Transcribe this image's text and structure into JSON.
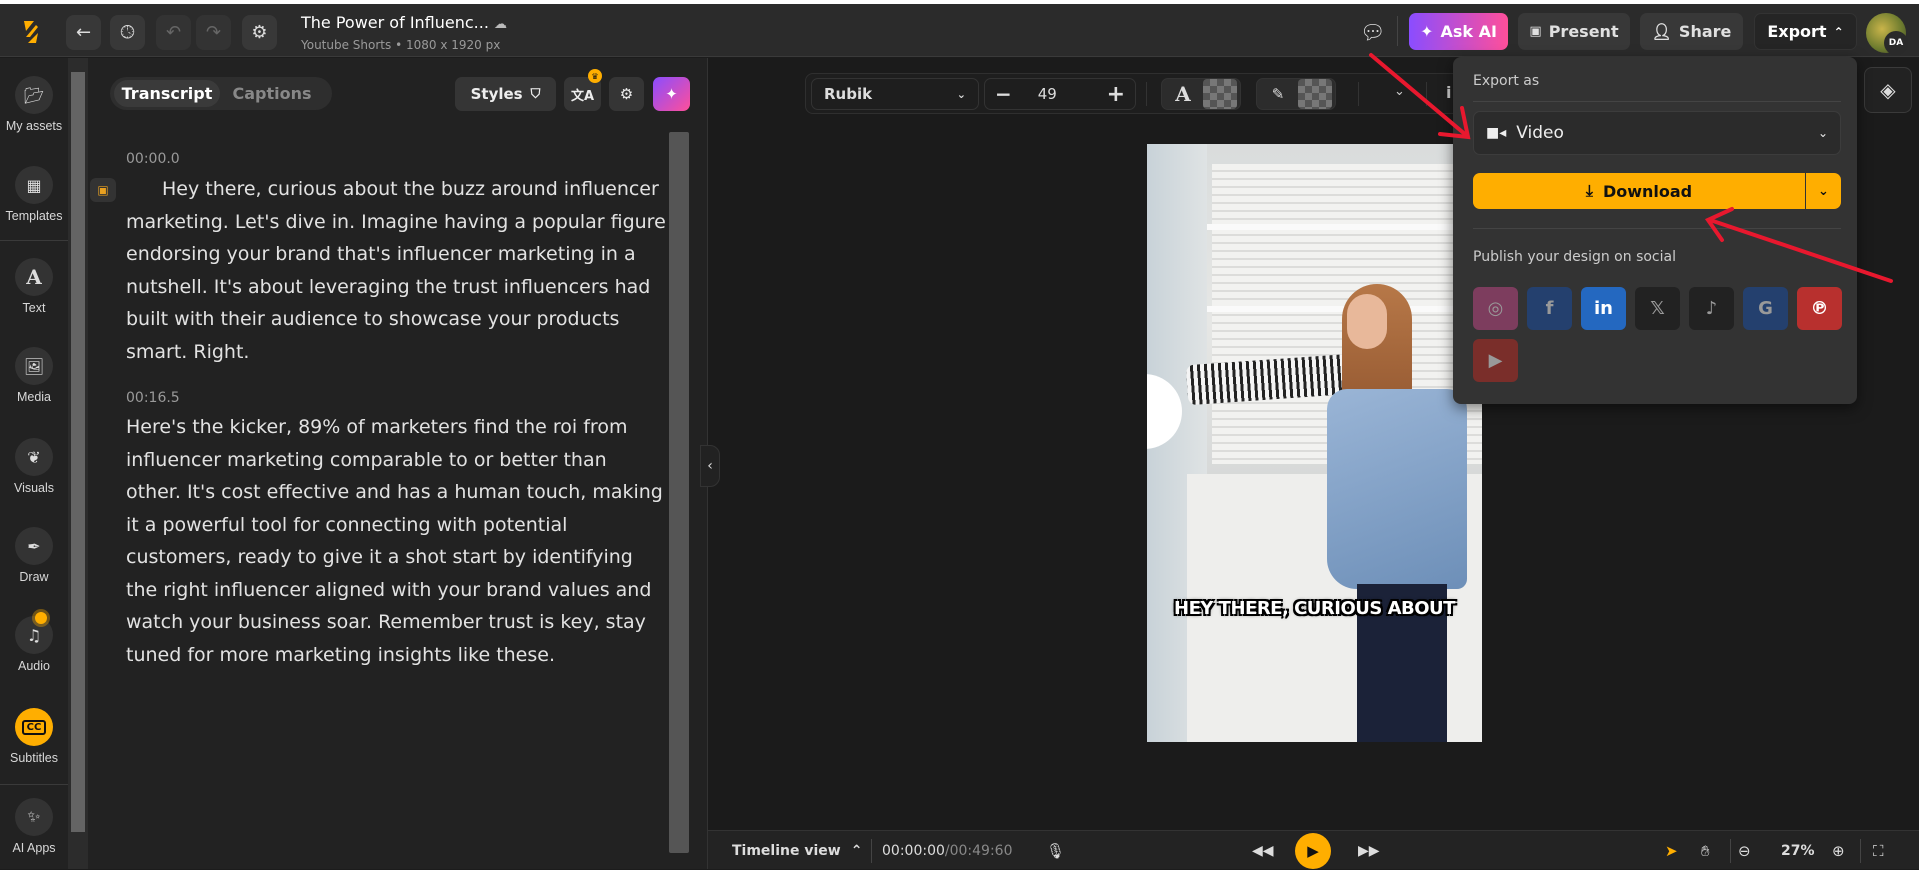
{
  "header": {
    "title": "The Power of Influenc...",
    "subtitle": "Youtube Shorts • 1080 x 1920 px",
    "ask_ai": "Ask AI",
    "present": "Present",
    "share": "Share",
    "export": "Export",
    "avatar_initials": "DA"
  },
  "sidebar": {
    "items": [
      {
        "label": "My assets",
        "icon": "folder-icon"
      },
      {
        "label": "Templates",
        "icon": "templates-icon"
      },
      {
        "label": "Text",
        "icon": "text-icon"
      },
      {
        "label": "Media",
        "icon": "image-icon"
      },
      {
        "label": "Visuals",
        "icon": "visuals-icon"
      },
      {
        "label": "Draw",
        "icon": "pen-icon"
      },
      {
        "label": "Audio",
        "icon": "music-icon"
      },
      {
        "label": "Subtitles",
        "icon": "cc-icon"
      },
      {
        "label": "AI Apps",
        "icon": "sparkle-icon"
      }
    ],
    "active": "Subtitles"
  },
  "panel": {
    "tabs": [
      "Transcript",
      "Captions"
    ],
    "active_tab": "Transcript",
    "styles_label": "Styles",
    "segments": [
      {
        "time": "00:00.0",
        "text": "Hey there, curious about the buzz around influencer marketing. Let's dive in. Imagine having a popular figure endorsing your brand that's influencer marketing in a nutshell. It's about leveraging the trust influencers had built with their audience to showcase your products smart. Right."
      },
      {
        "time": "00:16.5",
        "text": "Here's the kicker, 89% of marketers find the roi from influencer marketing comparable to or better than other. It's cost effective and has a human touch, making it a powerful tool for connecting with potential customers, ready to give it a shot start by identifying the right influencer aligned with your brand values and watch your business soar. Remember trust is key, stay tuned for more marketing insights like these."
      }
    ]
  },
  "toolbar": {
    "font": "Rubik",
    "font_size": "49"
  },
  "canvas": {
    "caption": "HEY THERE, CURIOUS ABOUT"
  },
  "export_menu": {
    "heading": "Export as",
    "format": "Video",
    "download": "Download",
    "publish_heading": "Publish your design on social",
    "socials": [
      "Instagram",
      "Facebook",
      "LinkedIn",
      "X",
      "TikTok",
      "Google",
      "Pinterest",
      "YouTube"
    ]
  },
  "bottom": {
    "timeline_view": "Timeline view",
    "current_time": "00:00:00",
    "total_time": "/00:49:60",
    "zoom": "27%"
  },
  "colors": {
    "accent": "#ffae00",
    "ask_ai_gradient": [
      "#8a4dff",
      "#ff4f9a"
    ],
    "annotation_arrow": "#e8182e"
  }
}
